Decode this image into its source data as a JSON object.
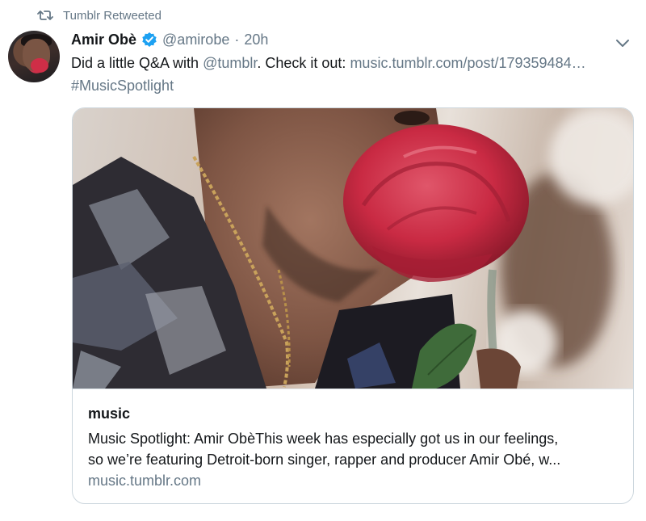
{
  "retweet": {
    "label": "Tumblr Retweeted"
  },
  "author": {
    "name": "Amir Obè",
    "handle": "@amirobe",
    "separator": "·",
    "time": "20h",
    "verified": true
  },
  "tweet": {
    "text_prefix": "Did a little Q&A with ",
    "mention": "@tumblr",
    "text_middle": ". Check it out: ",
    "link": "music.tumblr.com/post/179359484…",
    "hashtag": "#MusicSpotlight"
  },
  "card": {
    "title": "music",
    "description_line1": "Music Spotlight: Amir ObèThis week has especially got us in our feelings,",
    "description_line2": "so we’re featuring Detroit-born singer, rapper and producer Amir Obé, w...",
    "domain": "music.tumblr.com"
  },
  "icons": {
    "retweet": "retweet-icon",
    "verified": "verified-badge-icon",
    "menu": "chevron-down-icon"
  },
  "colors": {
    "text": "#14171a",
    "muted": "#657786",
    "verified": "#1da1f2",
    "border": "#ccd6dd",
    "rose": "#c9263f"
  }
}
